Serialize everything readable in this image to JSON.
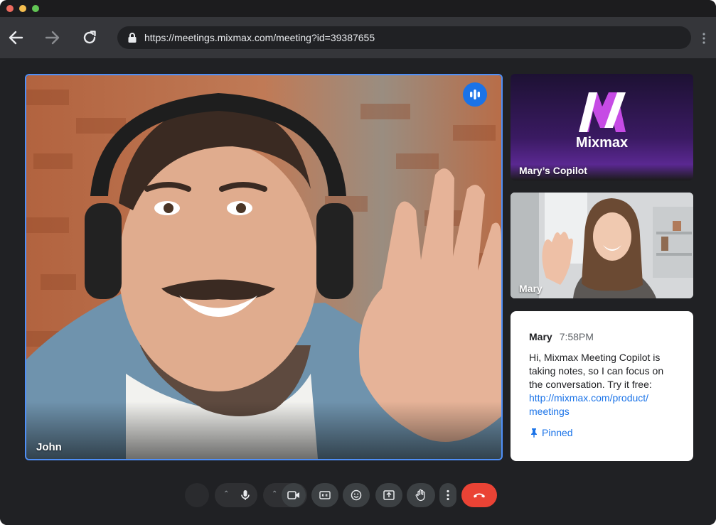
{
  "browser": {
    "url": "https://meetings.mixmax.com/meeting?id=39387655",
    "icons": [
      "back-arrow-icon",
      "forward-arrow-icon",
      "reload-icon",
      "lock-icon",
      "more-vert-icon"
    ]
  },
  "main_video": {
    "participant": "John",
    "speaking_icon": "audio-level-icon"
  },
  "side_tiles": [
    {
      "participant": "Mary’s Copilot",
      "brand": "Mixmax"
    },
    {
      "participant": "Mary"
    }
  ],
  "chat": {
    "sender": "Mary",
    "time": "7:58PM",
    "message": "Hi, Mixmax Meeting Copilot is taking notes, so I can focus on the conversation. Try it free:",
    "link": "http://mixmax.com/product/meetings",
    "link_line1": "http://mixmax.com/product/",
    "link_line2": "meetings",
    "pinned_label": "Pinned",
    "pin_icon": "pin-icon"
  },
  "controls": [
    {
      "name": "avatar",
      "icon": ""
    },
    {
      "name": "mic",
      "icon": "mic-icon"
    },
    {
      "name": "camera",
      "icon": "videocam-icon"
    },
    {
      "name": "captions",
      "icon": "closed-caption-icon"
    },
    {
      "name": "reactions",
      "icon": "emoji-icon"
    },
    {
      "name": "present",
      "icon": "present-screen-icon"
    },
    {
      "name": "raise-hand",
      "icon": "hand-icon"
    },
    {
      "name": "more",
      "icon": "more-vert-icon"
    },
    {
      "name": "leave",
      "icon": "call-end-icon"
    }
  ],
  "colors": {
    "accent": "#1a73e8",
    "active_border": "#4f8ff7",
    "end_call": "#ea4335",
    "brand_purple": "#c64be5",
    "background": "#202124"
  }
}
